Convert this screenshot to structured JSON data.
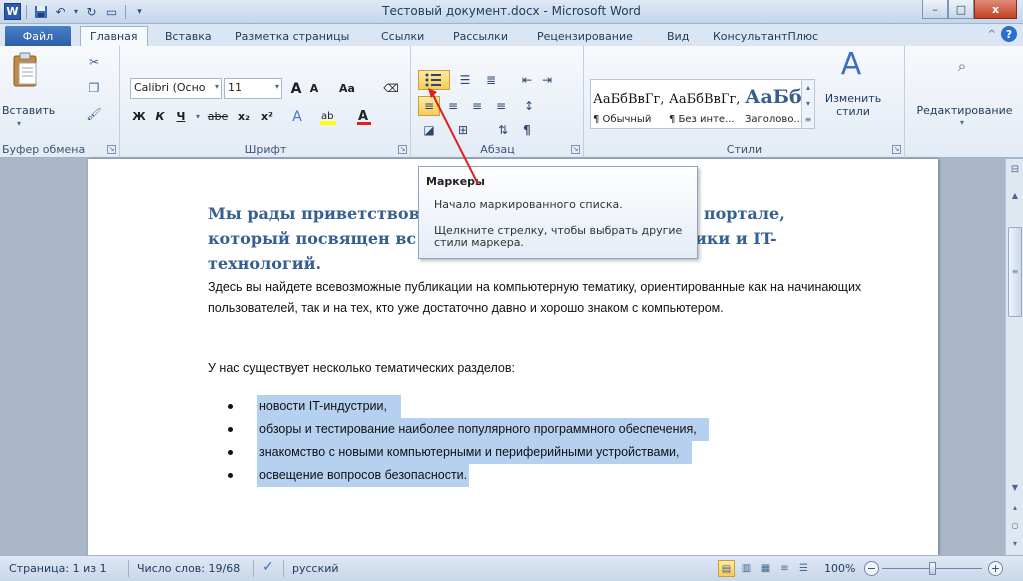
{
  "window": {
    "title": "Тестовый документ.docx - Microsoft Word",
    "app_letter": "W",
    "minimize": "–",
    "maximize": "□",
    "close": "x"
  },
  "tabs": [
    {
      "label": "Файл"
    },
    {
      "label": "Главная"
    },
    {
      "label": "Вставка"
    },
    {
      "label": "Разметка страницы"
    },
    {
      "label": "Ссылки"
    },
    {
      "label": "Рассылки"
    },
    {
      "label": "Рецензирование"
    },
    {
      "label": "Вид"
    },
    {
      "label": "КонсультантПлюс"
    }
  ],
  "ribbon": {
    "clipboard": {
      "paste": "Вставить",
      "label": "Буфер обмена"
    },
    "font": {
      "name": "Calibri (Осно",
      "size": "11",
      "grow": "A",
      "shrink": "A",
      "case": "Aa",
      "bold": "Ж",
      "italic": "К",
      "underline": "Ч",
      "strike": "abe",
      "sub": "x₂",
      "sup": "x²",
      "label": "Шрифт"
    },
    "paragraph": {
      "label": "Абзац"
    },
    "styles": {
      "items": [
        {
          "sample": "АаБбВвГг,",
          "name": "¶ Обычный"
        },
        {
          "sample": "АаБбВвГг,",
          "name": "¶ Без инте..."
        },
        {
          "sample": "АаБбВ",
          "name": "Заголово..."
        }
      ],
      "change": "Изменить стили",
      "label": "Стили"
    },
    "editing": {
      "label": "Редактирование"
    }
  },
  "tooltip": {
    "title": "Маркеры",
    "line1": "Начало маркированного списка.",
    "line2": "Щелкните стрелку, чтобы выбрать другие стили маркера."
  },
  "document": {
    "heading": "Мы рады приветствовать вас на нашем информационном портале, который посвящен всему миру компьютерной техники и IT-технологий.",
    "heading_visible_1": "Мы рады приветствов",
    "heading_visible_1b": "онном портале,",
    "heading_visible_2": "который посвящен вс",
    "heading_visible_2b": "й техники и IT-",
    "heading_visible_3": "технологий.",
    "para1": "Здесь вы найдете всевозможные публикации на компьютерную тематику, ориентированные как на начинающих пользователей, так и на тех, кто уже достаточно давно и хорошо знаком с компьютером.",
    "para2": "У нас существует несколько тематических разделов:",
    "bullets": [
      "новости IT-индустрии,",
      "обзоры и тестирование наиболее популярного программного обеспечения,",
      "знакомство с новыми компьютерными и периферийными устройствами,",
      "освещение вопросов безопасности."
    ]
  },
  "status": {
    "page": "Страница: 1 из 1",
    "words": "Число слов: 19/68",
    "language": "русский",
    "zoom": "100%",
    "zoom_level": 1.0
  },
  "colors": {
    "heading": "#365f91",
    "selection": "#b6d0ef",
    "file_tab": "#2b5ea8",
    "arrow": "#e0201b"
  }
}
